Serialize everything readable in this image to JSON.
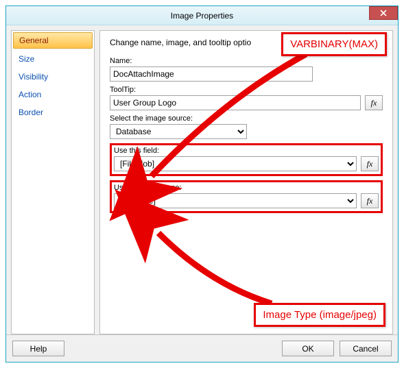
{
  "window": {
    "title": "Image Properties"
  },
  "sidebar": {
    "items": [
      {
        "label": "General",
        "selected": true
      },
      {
        "label": "Size",
        "selected": false
      },
      {
        "label": "Visibility",
        "selected": false
      },
      {
        "label": "Action",
        "selected": false
      },
      {
        "label": "Border",
        "selected": false
      }
    ]
  },
  "main": {
    "description": "Change name, image, and tooltip optio",
    "name_label": "Name:",
    "name_value": "DocAttachImage",
    "tooltip_label": "ToolTip:",
    "tooltip_value": "User Group Logo",
    "source_label": "Select the image source:",
    "source_value": "Database",
    "field_label": "Use this field:",
    "field_value": "[FileBlob]",
    "mime_label": "Use this MIME type:",
    "mime_value": "[FileType]",
    "fx": "fx"
  },
  "footer": {
    "help": "Help",
    "ok": "OK",
    "cancel": "Cancel"
  },
  "annotations": {
    "callout1": "VARBINARY(MAX)",
    "callout2": "Image Type (image/jpeg)"
  }
}
